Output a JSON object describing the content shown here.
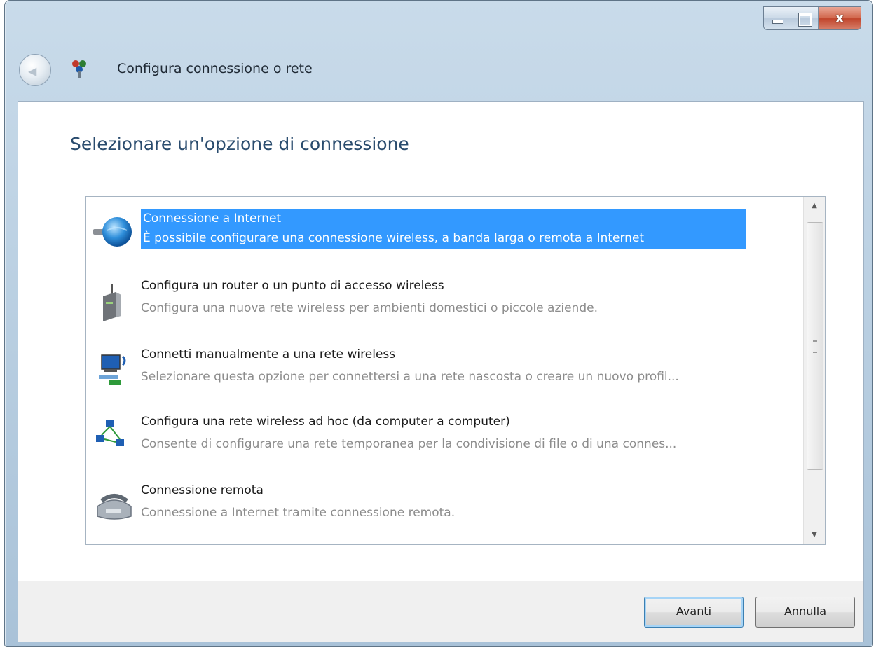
{
  "window": {
    "title": "Configura connessione o rete",
    "caption_buttons": [
      {
        "name": "minimize",
        "glyph": ""
      },
      {
        "name": "maximize",
        "glyph": ""
      },
      {
        "name": "close",
        "glyph": "x"
      }
    ]
  },
  "header": {
    "back_icon": "back-arrow-icon",
    "app_icon": "network-icon"
  },
  "main": {
    "heading": "Selezionare un'opzione di connessione",
    "options": [
      {
        "title": "Connessione a Internet",
        "description": "È possibile configurare una connessione wireless, a banda larga o remota a Internet",
        "icon": "globe-icon",
        "selected": true
      },
      {
        "title": "Configura un router o un punto di accesso wireless",
        "description": "Configura una nuova rete wireless per ambienti domestici o piccole aziende.",
        "icon": "router-icon",
        "selected": false
      },
      {
        "title": "Connetti manualmente a una rete wireless",
        "description": "Selezionare questa opzione per connettersi a una rete nascosta o creare un nuovo profil...",
        "icon": "wireless-computer-icon",
        "selected": false
      },
      {
        "title": "Configura una rete wireless ad hoc (da computer a computer)",
        "description": "Consente di configurare una rete temporanea per la condivisione di file o di una connes...",
        "icon": "adhoc-network-icon",
        "selected": false
      },
      {
        "title": "Connessione remota",
        "description": "Connessione a Internet tramite connessione remota.",
        "icon": "dialup-phone-icon",
        "selected": false
      }
    ]
  },
  "footer": {
    "next_label": "Avanti",
    "cancel_label": "Annulla"
  },
  "colors": {
    "selection": "#3399ff",
    "heading": "#2a4c6e"
  }
}
